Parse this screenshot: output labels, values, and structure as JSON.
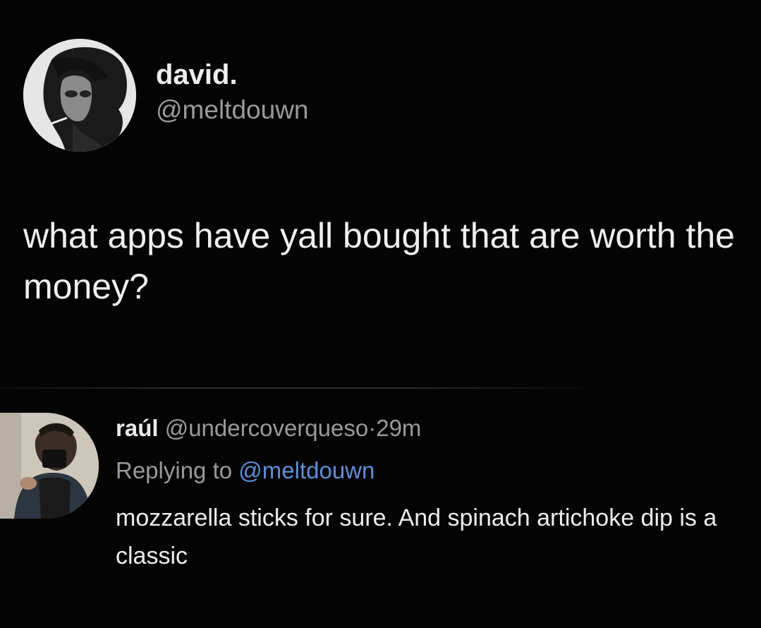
{
  "tweet": {
    "author": {
      "display_name": "david.",
      "handle": "@meltdouwn"
    },
    "text": "what apps have yall bought that are worth the money?"
  },
  "reply": {
    "author": {
      "display_name": "raúl",
      "handle": "@undercoverqueso"
    },
    "separator": "·",
    "time": "29m",
    "replying_prefix": "Replying to",
    "replying_to": "@meltdouwn",
    "text": "mozzarella sticks for sure. And spinach artichoke dip is a classic"
  },
  "colors": {
    "background": "#040404",
    "text": "#ececec",
    "muted": "#9a9a9a",
    "mention": "#5e8fd6"
  }
}
